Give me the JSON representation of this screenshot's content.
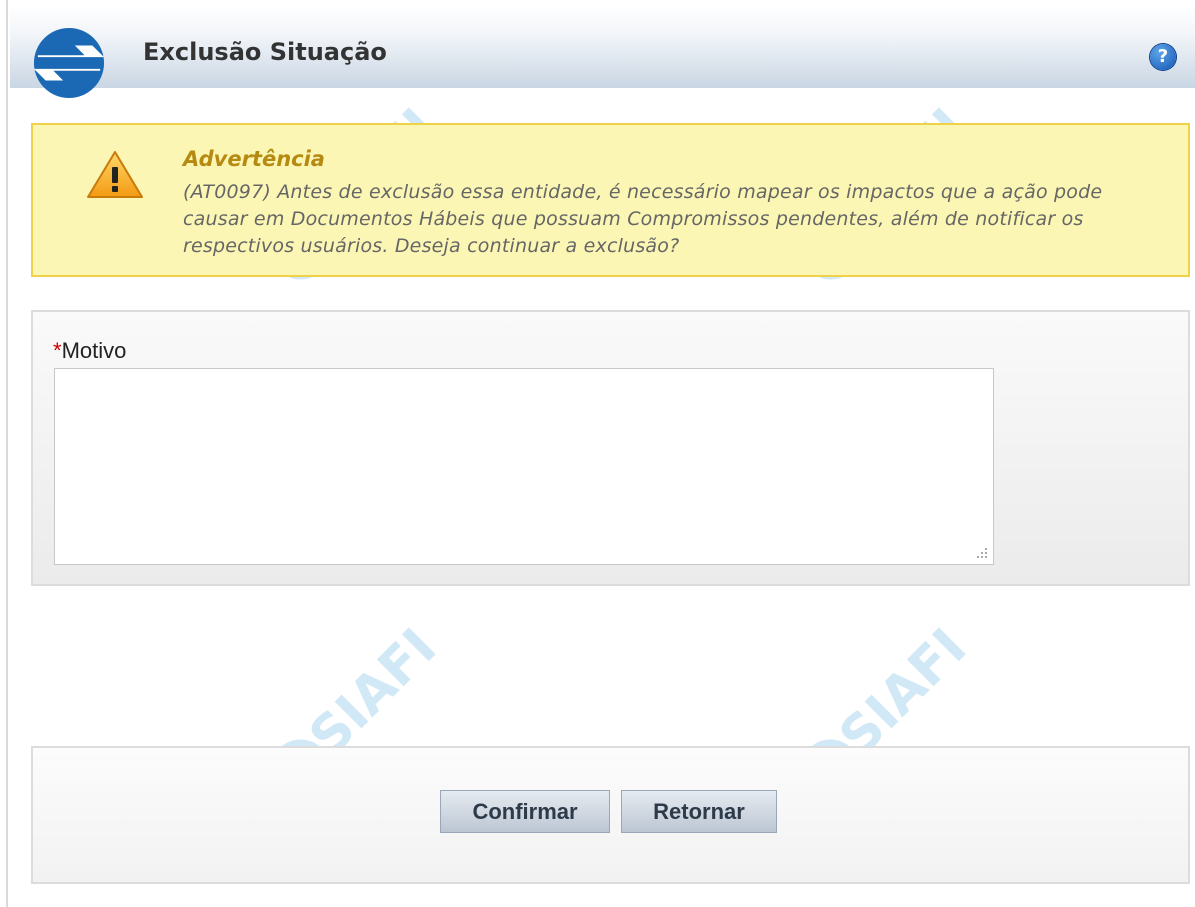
{
  "header": {
    "title": "Exclusão Situação",
    "help_label": "?"
  },
  "warning": {
    "title": "Advertência",
    "message": "(AT0097) Antes de exclusão essa entidade, é necessário mapear os impactos que a ação pode causar em Documentos Hábeis que possuam Compromissos pendentes, além de notificar os respectivos usuários. Deseja continuar a exclusão?"
  },
  "form": {
    "required_marker": "*",
    "motivo_label": "Motivo",
    "motivo_value": ""
  },
  "actions": {
    "confirm_label": "Confirmar",
    "return_label": "Retornar"
  },
  "watermark": {
    "text": "SIAFI"
  },
  "colors": {
    "warning_bg": "#fbf6b4",
    "warning_border": "#f0d248",
    "warning_title": "#b68a10",
    "brand_blue": "#1b69b5",
    "help_blue": "#1256b5",
    "required": "#cc0000"
  }
}
